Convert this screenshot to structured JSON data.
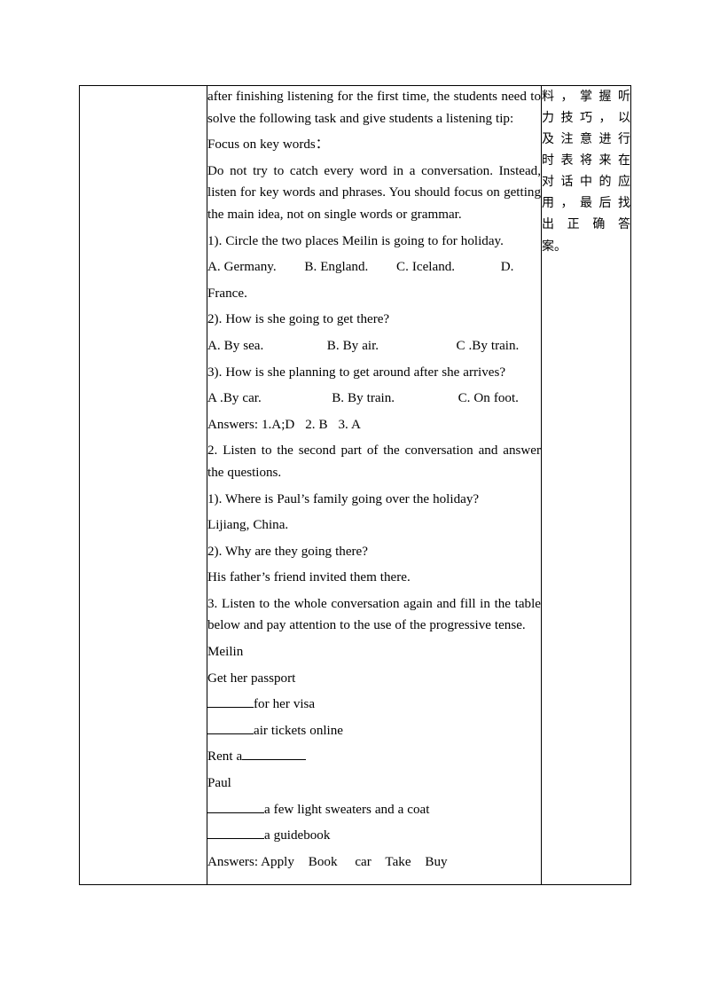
{
  "document": {
    "type": "lesson-plan-table",
    "page_background": "#ffffff",
    "border_color": "#000000"
  },
  "table": {
    "columns": [
      "",
      "",
      ""
    ],
    "left_cell": {
      "content": ""
    },
    "notes_cell": {
      "lines": [
        "料，掌握听",
        "力技巧，以",
        "及注意进行",
        "时表将来在",
        "对话中的应",
        "用，最后找",
        "出 正 确 答",
        "案。"
      ],
      "full_text": "料，掌握听力技巧，以及注意进行时表将来在对话中的应用，最后找出正确答案。"
    },
    "main_cell": {
      "paragraphs": [
        "after finishing listening for the first time, the students need to solve the following task and give students a listening tip:",
        "Focus on key words：",
        "Do not try to catch every word in a conversation. Instead, listen for key words and phrases. You should focus on getting the main idea, not on single words or grammar.",
        "1). Circle the two places Meilin is going to for holiday."
      ],
      "q1_options": "A. Germany.        B. England.        C. Iceland.             D. France.",
      "q1_options_line1": "A. Germany.        B. England.        C. Iceland.             D.",
      "q1_options_line2": "France.",
      "q2_prompt": "2). How is she going to get there?",
      "q2_options": "A. By sea.                  B. By air.                      C .By train.",
      "q3_prompt": "3). How is she planning to get around after she arrives?",
      "q3_options": "A .By car.                    B. By train.                  C. On foot.",
      "answers_1": "Answers: 1.A;D   2. B   3. A",
      "task2_instruction": "2. Listen to the second part of the conversation and answer the questions.",
      "task2_q1": "1). Where is Paul’s family going over the holiday?",
      "task2_a1": "Lijiang, China.",
      "task2_q2": "2). Why are they going there?",
      "task2_a2": "His father’s friend invited them there.",
      "task3_instruction": "3. Listen to the whole conversation again and fill in the table below and pay attention to the use of the progressive tense.",
      "table_rows": [
        {
          "name": "Meilin"
        },
        {
          "text": "Get her passport"
        },
        {
          "blank": true,
          "text": "for her visa"
        },
        {
          "blank": true,
          "text": "air tickets online"
        },
        {
          "text": "Rent a",
          "blank_after": true
        },
        {
          "name": "Paul"
        },
        {
          "blank": true,
          "text": "a few light sweaters and a coat"
        },
        {
          "blank": true,
          "text": "a guidebook"
        }
      ],
      "answers_3": "Answers: Apply    Book     car    Take    Buy"
    }
  }
}
